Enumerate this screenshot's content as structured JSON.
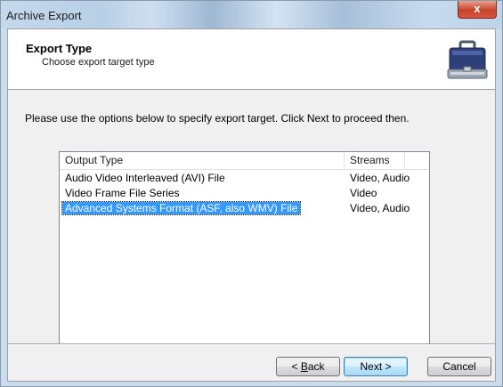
{
  "window": {
    "title": "Archive Export",
    "close_glyph": "x"
  },
  "header": {
    "title": "Export Type",
    "subtitle": "Choose export target type",
    "icon": "briefcase-icon"
  },
  "instructions": "Please use the options below to specify export target. Click Next to proceed then.",
  "list": {
    "columns": [
      "Output Type",
      "Streams"
    ],
    "rows": [
      {
        "type": "Audio Video Interleaved (AVI) File",
        "streams": "Video, Audio",
        "selected": false
      },
      {
        "type": "Video Frame File Series",
        "streams": "Video",
        "selected": false
      },
      {
        "type": "Advanced Systems Format (ASF, also WMV) File",
        "streams": "Video, Audio",
        "selected": true
      }
    ]
  },
  "buttons": {
    "back_prefix": "< ",
    "back_mnemonic": "B",
    "back_rest": "ack",
    "next": "Next >",
    "cancel": "Cancel"
  },
  "colors": {
    "selection": "#3399ff",
    "titlebar": "#c5d9ec",
    "close": "#c7442b"
  }
}
